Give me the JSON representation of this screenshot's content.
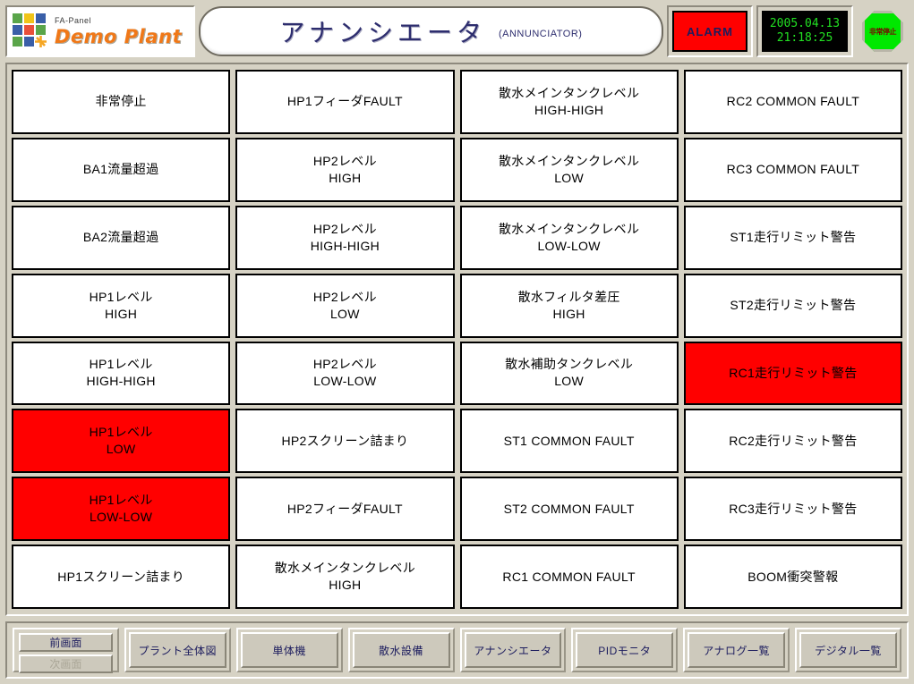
{
  "header": {
    "logo": {
      "brand_small": "FA-Panel",
      "brand_main": "Demo Plant",
      "cells": [
        "#5aa54a",
        "#f0c419",
        "#3a5fa8",
        "#3a5fa8",
        "#e8503a",
        "#5aa54a",
        "#5aa54a",
        "#3a5fa8"
      ],
      "gear_color": "#f5a623"
    },
    "title": "アナンシエータ",
    "title_en": "(ANNUNCIATOR)",
    "alarm_label": "ALARM",
    "alarm_color": "#ff0000",
    "clock_date": "2005.04.13",
    "clock_time": "21:18:25",
    "clock_color": "#22e022",
    "estop_label": "非常停止",
    "estop_color": "#00e800"
  },
  "grid": {
    "active_color": "#ff0000",
    "columns": [
      {
        "tiles": [
          {
            "label": "非常停止",
            "active": false
          },
          {
            "label": "BA1流量超過",
            "active": false
          },
          {
            "label": "BA2流量超過",
            "active": false
          },
          {
            "label": "HP1レベル\nHIGH",
            "active": false
          },
          {
            "label": "HP1レベル\nHIGH-HIGH",
            "active": false
          },
          {
            "label": "HP1レベル\nLOW",
            "active": true
          },
          {
            "label": "HP1レベル\nLOW-LOW",
            "active": true
          },
          {
            "label": "HP1スクリーン詰まり",
            "active": false
          }
        ]
      },
      {
        "tiles": [
          {
            "label": "HP1フィーダFAULT",
            "active": false
          },
          {
            "label": "HP2レベル\nHIGH",
            "active": false
          },
          {
            "label": "HP2レベル\nHIGH-HIGH",
            "active": false
          },
          {
            "label": "HP2レベル\nLOW",
            "active": false
          },
          {
            "label": "HP2レベル\nLOW-LOW",
            "active": false
          },
          {
            "label": "HP2スクリーン詰まり",
            "active": false
          },
          {
            "label": "HP2フィーダFAULT",
            "active": false
          },
          {
            "label": "散水メインタンクレベル\nHIGH",
            "active": false
          }
        ]
      },
      {
        "tiles": [
          {
            "label": "散水メインタンクレベル\nHIGH-HIGH",
            "active": false
          },
          {
            "label": "散水メインタンクレベル\nLOW",
            "active": false
          },
          {
            "label": "散水メインタンクレベル\nLOW-LOW",
            "active": false
          },
          {
            "label": "散水フィルタ差圧\nHIGH",
            "active": false
          },
          {
            "label": "散水補助タンクレベル\nLOW",
            "active": false
          },
          {
            "label": "ST1 COMMON FAULT",
            "active": false
          },
          {
            "label": "ST2 COMMON FAULT",
            "active": false
          },
          {
            "label": "RC1 COMMON FAULT",
            "active": false
          }
        ]
      },
      {
        "tiles": [
          {
            "label": "RC2 COMMON FAULT",
            "active": false
          },
          {
            "label": "RC3 COMMON FAULT",
            "active": false
          },
          {
            "label": "ST1走行リミット警告",
            "active": false
          },
          {
            "label": "ST2走行リミット警告",
            "active": false
          },
          {
            "label": "RC1走行リミット警告",
            "active": true
          },
          {
            "label": "RC2走行リミット警告",
            "active": false
          },
          {
            "label": "RC3走行リミット警告",
            "active": false
          },
          {
            "label": "BOOM衝突警報",
            "active": false
          }
        ]
      }
    ]
  },
  "toolbar": {
    "nav_prev": "前画面",
    "nav_next": "次画面",
    "buttons": [
      "プラント全体図",
      "単体機",
      "散水設備",
      "アナンシエータ",
      "PIDモニタ",
      "アナログ一覧",
      "デジタル一覧"
    ]
  }
}
